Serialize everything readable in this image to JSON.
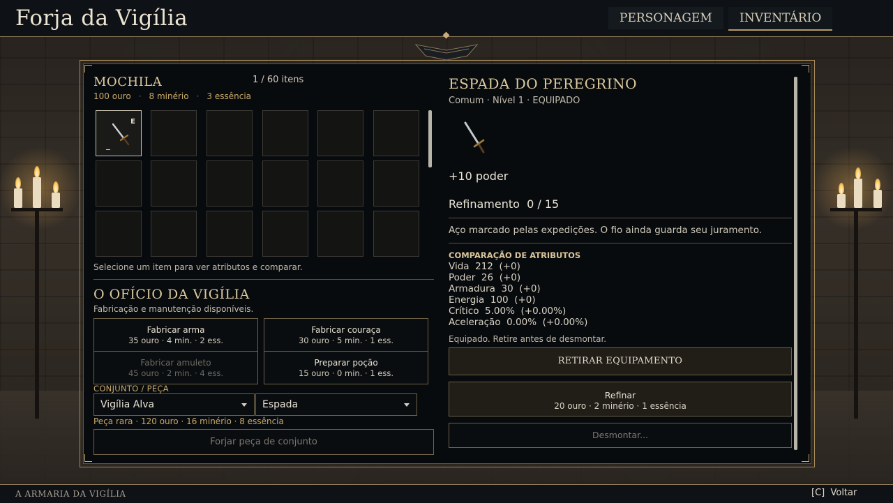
{
  "header": {
    "title": "Forja da Vigília",
    "tabs": [
      {
        "label": "Personagem",
        "active": false
      },
      {
        "label": "Inventário",
        "active": true
      }
    ]
  },
  "inventory": {
    "title": "Mochila",
    "count": "1 / 60 itens",
    "gold": "100 ouro",
    "ore": "8 minério",
    "essence": "3 essência",
    "equipped_badge": "E",
    "hint": "Selecione um item para ver atributos e comparar."
  },
  "crafting": {
    "title": "O ofício da Vigília",
    "subtitle": "Fabricação e manutenção disponíveis.",
    "options": [
      {
        "label": "Fabricar arma",
        "cost": "35 ouro · 4 min. · 2 ess.",
        "enabled": true
      },
      {
        "label": "Fabricar couraça",
        "cost": "30 ouro · 5 min. · 1 ess.",
        "enabled": true
      },
      {
        "label": "Fabricar amuleto",
        "cost": "45 ouro · 2 min. · 4 ess.",
        "enabled": false
      },
      {
        "label": "Preparar poção",
        "cost": "15 ouro · 0 min. · 1 ess.",
        "enabled": true
      }
    ],
    "set_label": "CONJUNTO / PEÇA",
    "set_select": "Vigília Alva",
    "piece_select": "Espada",
    "set_cost": "Peça rara · 120 ouro · 16 minério · 8 essência",
    "forge_button": "Forjar peça de conjunto"
  },
  "item": {
    "name": "Espada do peregrino",
    "meta": "Comum · Nível 1 · EQUIPADO",
    "icon": "sword-icon",
    "power": "+10 poder",
    "refinement": "Refinamento  0 / 15",
    "flavor": "Aço marcado pelas expedições. O fio ainda guarda seu juramento.",
    "compare_title": "COMPARAÇÃO DE ATRIBUTOS",
    "stats": [
      "Vida  212  (+0)",
      "Poder  26  (+0)",
      "Armadura  30  (+0)",
      "Energia  100  (+0)",
      "Crítico  5.00%  (+0.00%)",
      "Aceleração  0.00%  (+0.00%)"
    ],
    "equipped_note": "Equipado. Retire antes de desmontar.",
    "unequip_button": "Retirar equipamento",
    "refine_button": "Refinar",
    "refine_cost": "20 ouro · 2 minério · 1 essência",
    "dismantle_button": "Desmontar..."
  },
  "footer": {
    "title": "A ARMARIA DA VIGÍLIA",
    "back_hint": "[C]  Voltar"
  },
  "colors": {
    "accent_gold": "#c9a96a",
    "panel_bg": "#080b0e",
    "frame": "#a68c5c"
  }
}
